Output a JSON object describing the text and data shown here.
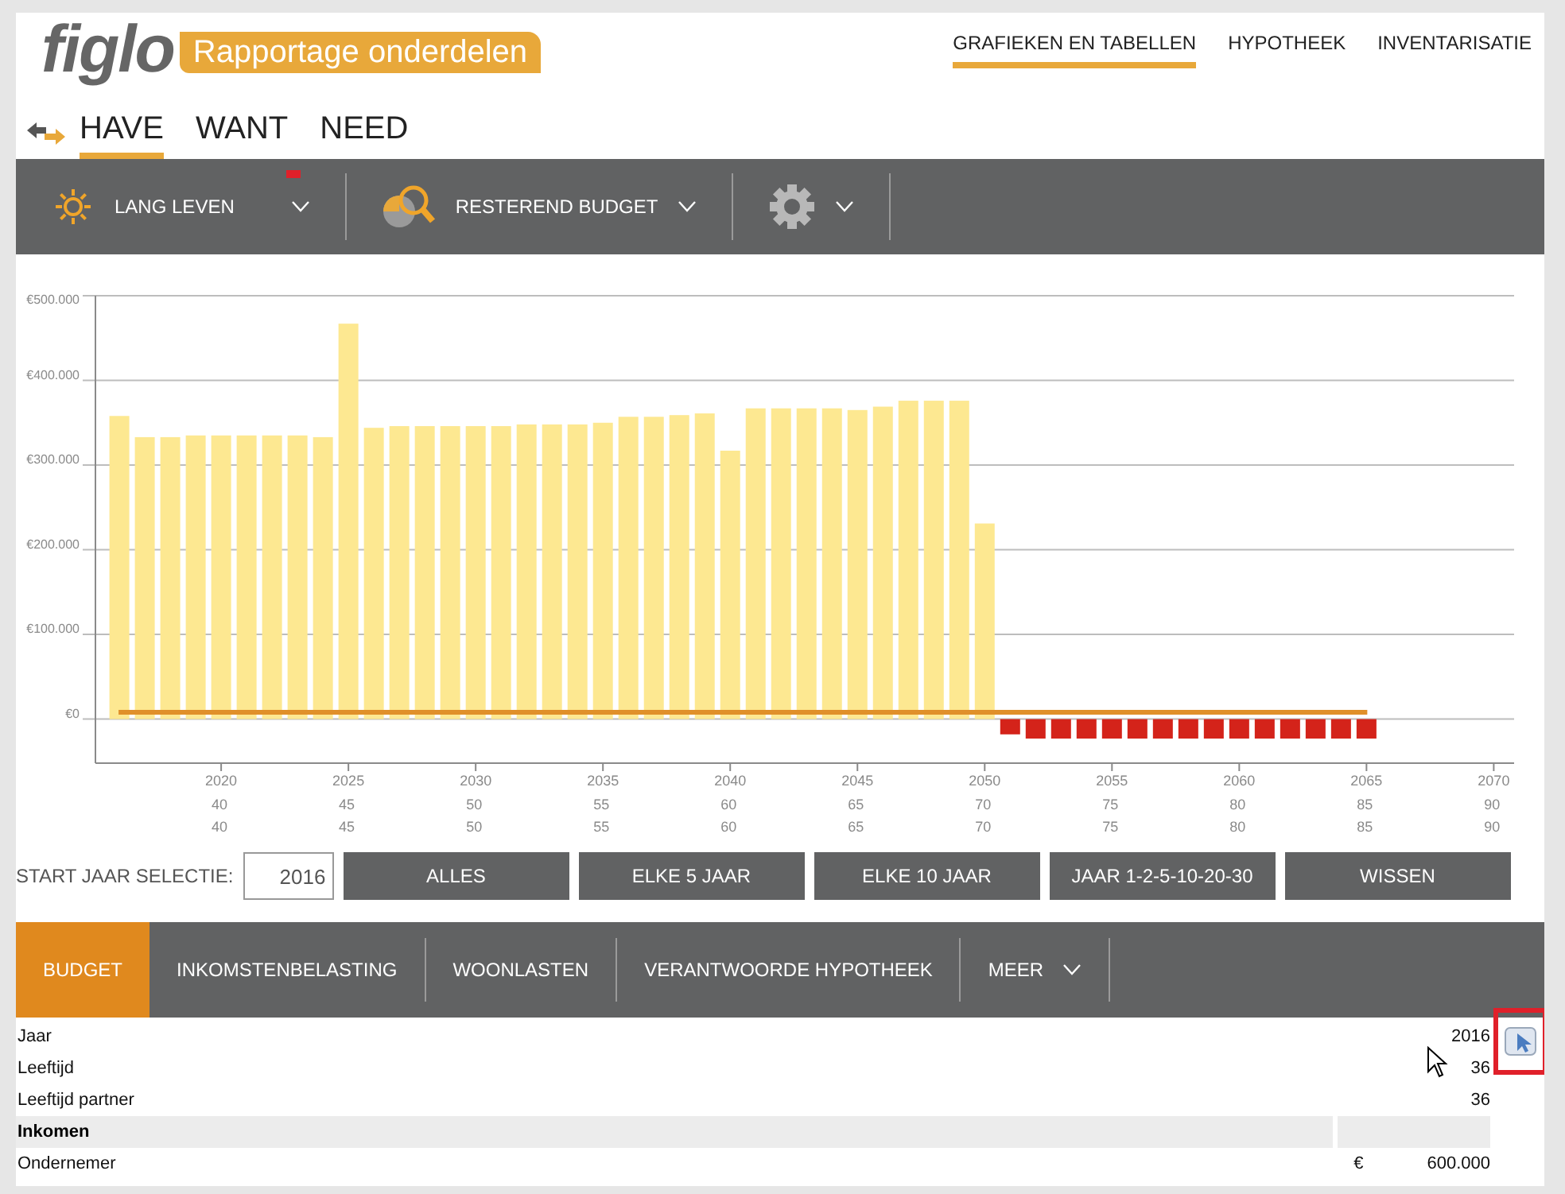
{
  "header": {
    "logo": "figlo",
    "subtitle": "Rapportage onderdelen",
    "nav": [
      {
        "label": "GRAFIEKEN EN TABELLEN",
        "selected": true
      },
      {
        "label": "HYPOTHEEK",
        "selected": false
      },
      {
        "label": "INVENTARISATIE",
        "selected": false
      }
    ]
  },
  "view_tabs": [
    {
      "label": "HAVE",
      "selected": true
    },
    {
      "label": "WANT",
      "selected": false
    },
    {
      "label": "NEED",
      "selected": false
    }
  ],
  "toolbar": [
    {
      "kind": "sun",
      "label": "LANG LEVEN",
      "marker": true
    },
    {
      "kind": "search",
      "label": "RESTEREND BUDGET",
      "marker": false
    },
    {
      "kind": "gear",
      "marker": false
    }
  ],
  "chart": {
    "chart_data": {
      "type": "bar",
      "x": [
        2016,
        2017,
        2018,
        2019,
        2020,
        2021,
        2022,
        2023,
        2024,
        2025,
        2026,
        2027,
        2028,
        2029,
        2030,
        2031,
        2032,
        2033,
        2034,
        2035,
        2036,
        2037,
        2038,
        2039,
        2040,
        2041,
        2042,
        2043,
        2044,
        2045,
        2046,
        2047,
        2048,
        2049,
        2050,
        2051,
        2052,
        2053,
        2054,
        2055,
        2056,
        2057,
        2058,
        2059,
        2060,
        2061,
        2062,
        2063,
        2064,
        2065
      ],
      "grid": true,
      "series": [
        {
          "color": "#fde891",
          "values": [
            358000,
            333000,
            333000,
            335000,
            335000,
            335000,
            335000,
            335000,
            333000,
            467000,
            344000,
            346000,
            346000,
            346000,
            346000,
            346000,
            348000,
            348000,
            348000,
            350000,
            357000,
            357000,
            359000,
            361000,
            317000,
            367000,
            367000,
            367000,
            367000,
            365000,
            369000,
            376000,
            376000,
            376000,
            231000,
            null,
            null,
            null,
            null,
            null,
            null,
            null,
            null,
            null,
            null,
            null,
            null,
            null,
            null,
            null
          ]
        },
        {
          "color": "#d4231a",
          "values": [
            null,
            null,
            null,
            null,
            null,
            null,
            null,
            null,
            null,
            null,
            null,
            null,
            null,
            null,
            null,
            null,
            null,
            null,
            null,
            null,
            null,
            null,
            null,
            null,
            null,
            null,
            null,
            null,
            null,
            null,
            null,
            null,
            null,
            null,
            null,
            -18000,
            -23000,
            -23000,
            -23000,
            -23000,
            -23000,
            -23000,
            -23000,
            -23000,
            -23000,
            -23000,
            -23000,
            -23000,
            -23000,
            -23000
          ]
        }
      ],
      "xlim": [
        2015.06,
        2070.8
      ],
      "ylim": [
        -52000,
        500000
      ],
      "xticks": [
        2020,
        2025,
        2030,
        2035,
        2040,
        2045,
        2050,
        2055,
        2060,
        2065,
        2070
      ],
      "ref_lines": [
        {
          "axis": "y",
          "value": 8000,
          "color": "#e0902a"
        }
      ],
      "yticks": [
        {
          "value": 0,
          "label": "€0"
        },
        {
          "value": 100000,
          "label": "€100.000"
        },
        {
          "value": 200000,
          "label": "€200.000"
        },
        {
          "value": 300000,
          "label": "€300.000"
        },
        {
          "value": 400000,
          "label": "€400.000"
        },
        {
          "value": 500000,
          "label": "€500.000"
        }
      ]
    },
    "age_rows": [
      [
        "40",
        "45",
        "50",
        "55",
        "60",
        "65",
        "70",
        "75",
        "80",
        "85",
        "90"
      ],
      [
        "40",
        "45",
        "50",
        "55",
        "60",
        "65",
        "70",
        "75",
        "80",
        "85",
        "90"
      ]
    ]
  },
  "selection": {
    "label": "START JAAR SELECTIE:",
    "value": "2016",
    "buttons": [
      "ALLES",
      "ELKE 5 JAAR",
      "ELKE 10 JAAR",
      "JAAR 1-2-5-10-20-30",
      "WISSEN"
    ]
  },
  "table_tabs": [
    {
      "label": "BUDGET",
      "selected": true,
      "dropdown": false
    },
    {
      "label": "INKOMSTENBELASTING",
      "selected": false,
      "dropdown": false
    },
    {
      "label": "WOONLASTEN",
      "selected": false,
      "dropdown": false
    },
    {
      "label": "VERANTWOORDE HYPOTHEEK",
      "selected": false,
      "dropdown": false
    },
    {
      "label": "MEER",
      "selected": false,
      "dropdown": true
    }
  ],
  "table": {
    "rows": [
      {
        "kind": "row",
        "label": "Jaar",
        "value": "2016"
      },
      {
        "kind": "row",
        "label": "Leeftijd",
        "value": "36"
      },
      {
        "kind": "row",
        "label": "Leeftijd partner",
        "value": "36"
      },
      {
        "kind": "section",
        "label": "Inkomen"
      },
      {
        "kind": "row",
        "label": "Ondernemer",
        "currency": "€",
        "value": "600.000"
      }
    ]
  }
}
